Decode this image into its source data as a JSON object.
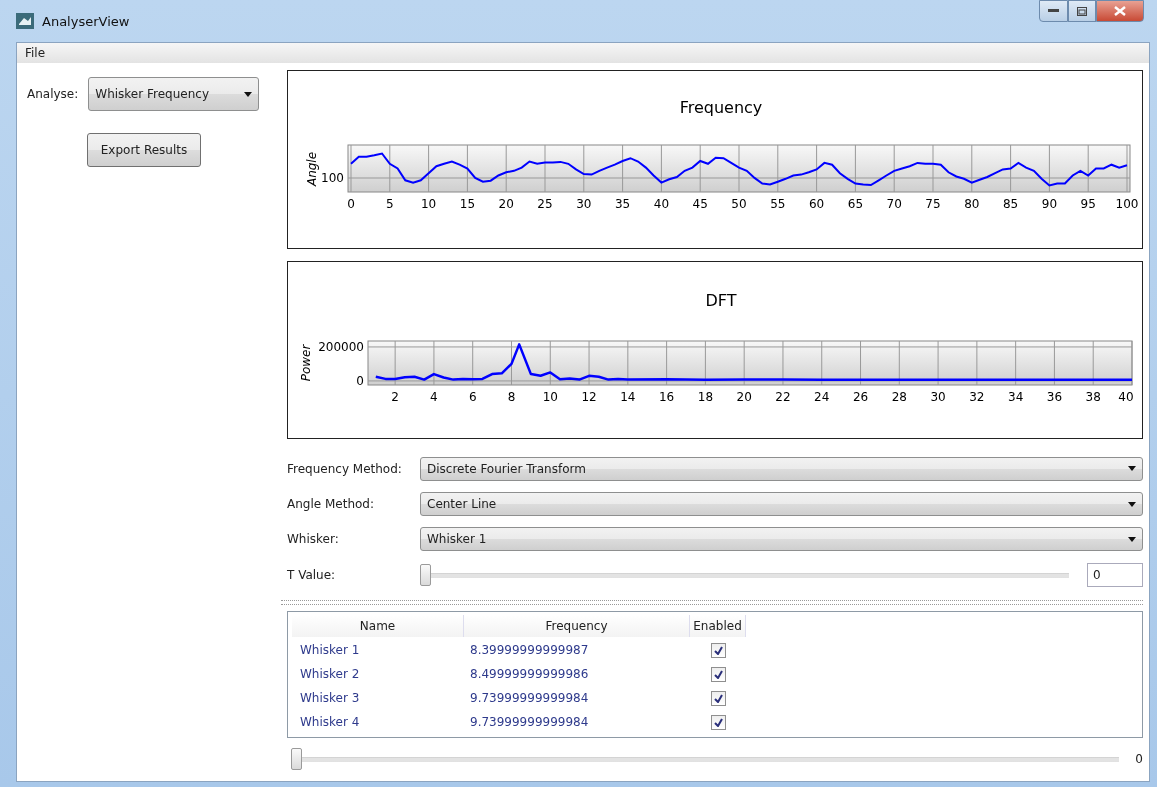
{
  "window": {
    "title": "AnalyserView"
  },
  "menu": [
    {
      "label": "File"
    }
  ],
  "analyse": {
    "label": "Analyse:",
    "value": "Whisker Frequency"
  },
  "export_button": "Export Results",
  "frequency_chart": {
    "title": "Frequency",
    "ylabel": "Angle",
    "ytick": "100",
    "xticks": [
      "0",
      "5",
      "10",
      "15",
      "20",
      "25",
      "30",
      "35",
      "40",
      "45",
      "50",
      "55",
      "60",
      "65",
      "70",
      "75",
      "80",
      "85",
      "90",
      "95",
      "100"
    ]
  },
  "dft_chart": {
    "chart_data": {
      "type": "line",
      "grid": true,
      "title": "DFT",
      "ylabel": "Power",
      "xlim": [
        0.6,
        40
      ],
      "ylim": [
        -24000,
        235000
      ],
      "yticks": [
        0,
        200000
      ],
      "xticks": [
        2,
        4,
        6,
        8,
        10,
        12,
        14,
        16,
        18,
        20,
        22,
        24,
        26,
        28,
        30,
        32,
        34,
        36,
        38,
        40
      ],
      "x": [
        1,
        1.5,
        2,
        2.5,
        3,
        3.5,
        4,
        4.5,
        5,
        5.5,
        6,
        6.5,
        7,
        7.5,
        8,
        8.4,
        9,
        9.5,
        10,
        10.5,
        11,
        11.5,
        12,
        12.5,
        13,
        13.5,
        14,
        16,
        18,
        20,
        22,
        24,
        26,
        28,
        30,
        32,
        34,
        36,
        38,
        40
      ],
      "series": [
        {
          "color": "#0000ff",
          "values": [
            25000,
            12000,
            12000,
            22000,
            25000,
            8000,
            40000,
            20000,
            8000,
            12000,
            10000,
            12000,
            40000,
            45000,
            100000,
            215000,
            40000,
            30000,
            50000,
            10000,
            15000,
            8000,
            30000,
            25000,
            8000,
            12000,
            8000,
            10000,
            7000,
            8000,
            8000,
            7000,
            7000,
            7000,
            7000,
            7000,
            7000,
            7000,
            7000,
            7000
          ]
        }
      ]
    }
  },
  "settings": [
    {
      "kind": "combo",
      "label": "Frequency Method:",
      "value": "Discrete Fourier Transform"
    },
    {
      "kind": "combo",
      "label": "Angle Method:",
      "value": "Center Line"
    },
    {
      "kind": "combo",
      "label": "Whisker:",
      "value": "Whisker 1"
    },
    {
      "kind": "slider",
      "label": "T Value:",
      "level": 0,
      "value": "0"
    }
  ],
  "table": {
    "columns": [
      "Name",
      "Frequency",
      "Enabled"
    ],
    "rows": [
      {
        "name": "Whisker 1",
        "frequency": "8.39999999999987",
        "enabled": true
      },
      {
        "name": "Whisker 2",
        "frequency": "8.49999999999986",
        "enabled": true
      },
      {
        "name": "Whisker 3",
        "frequency": "9.73999999999984",
        "enabled": true
      },
      {
        "name": "Whisker 4",
        "frequency": "9.73999999999984",
        "enabled": true
      }
    ]
  },
  "bottom_slider": {
    "level": 0,
    "reading": "0"
  }
}
